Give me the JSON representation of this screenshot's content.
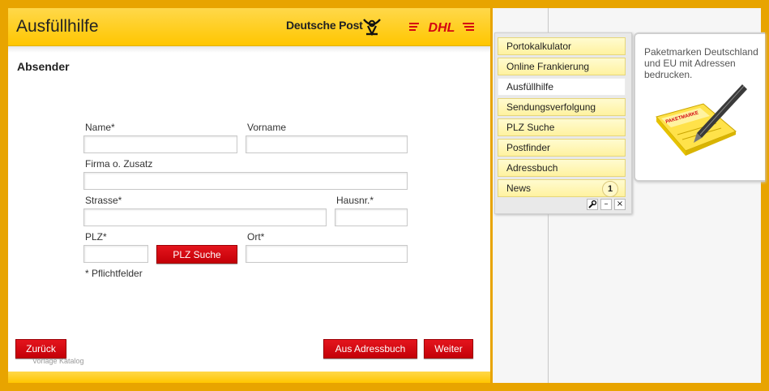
{
  "header": {
    "title": "Ausfüllhilfe",
    "brand_deutsche_post": "Deutsche Post",
    "brand_dhl": "DHL"
  },
  "form": {
    "section_title": "Absender",
    "labels": {
      "name": "Name*",
      "vorname": "Vorname",
      "firma": "Firma o. Zusatz",
      "strasse": "Strasse*",
      "hausnr": "Hausnr.*",
      "plz": "PLZ*",
      "ort": "Ort*"
    },
    "values": {
      "name": "",
      "vorname": "",
      "firma": "",
      "strasse": "",
      "hausnr": "",
      "plz": "",
      "ort": ""
    },
    "plz_search_button": "PLZ Suche",
    "required_note": "* Pflichtfelder"
  },
  "footer": {
    "back_button": "Zurück",
    "address_book_button": "Aus Adressbuch",
    "next_button": "Weiter",
    "watermark": "Vorlage Katalog"
  },
  "menu": {
    "items": [
      {
        "label": "Portokalkulator",
        "active": false
      },
      {
        "label": "Online Frankierung",
        "active": false
      },
      {
        "label": "Ausfüllhilfe",
        "active": true
      },
      {
        "label": "Sendungsverfolgung",
        "active": false
      },
      {
        "label": "PLZ Suche",
        "active": false
      },
      {
        "label": "Postfinder",
        "active": false
      },
      {
        "label": "Adressbuch",
        "active": false
      },
      {
        "label": "News",
        "active": false
      }
    ],
    "news_count": "1",
    "controls": {
      "settings_icon": "wrench-icon",
      "minimize_glyph": "–",
      "close_glyph": "×"
    }
  },
  "info": {
    "text": "Paketmarken Deutschland und EU mit Adressen bedrucken.",
    "illustration_label": "PAKETMARKE"
  },
  "colors": {
    "dhl_yellow": "#ffcc00",
    "dhl_red": "#d40511",
    "frame_orange": "#e8a400"
  }
}
